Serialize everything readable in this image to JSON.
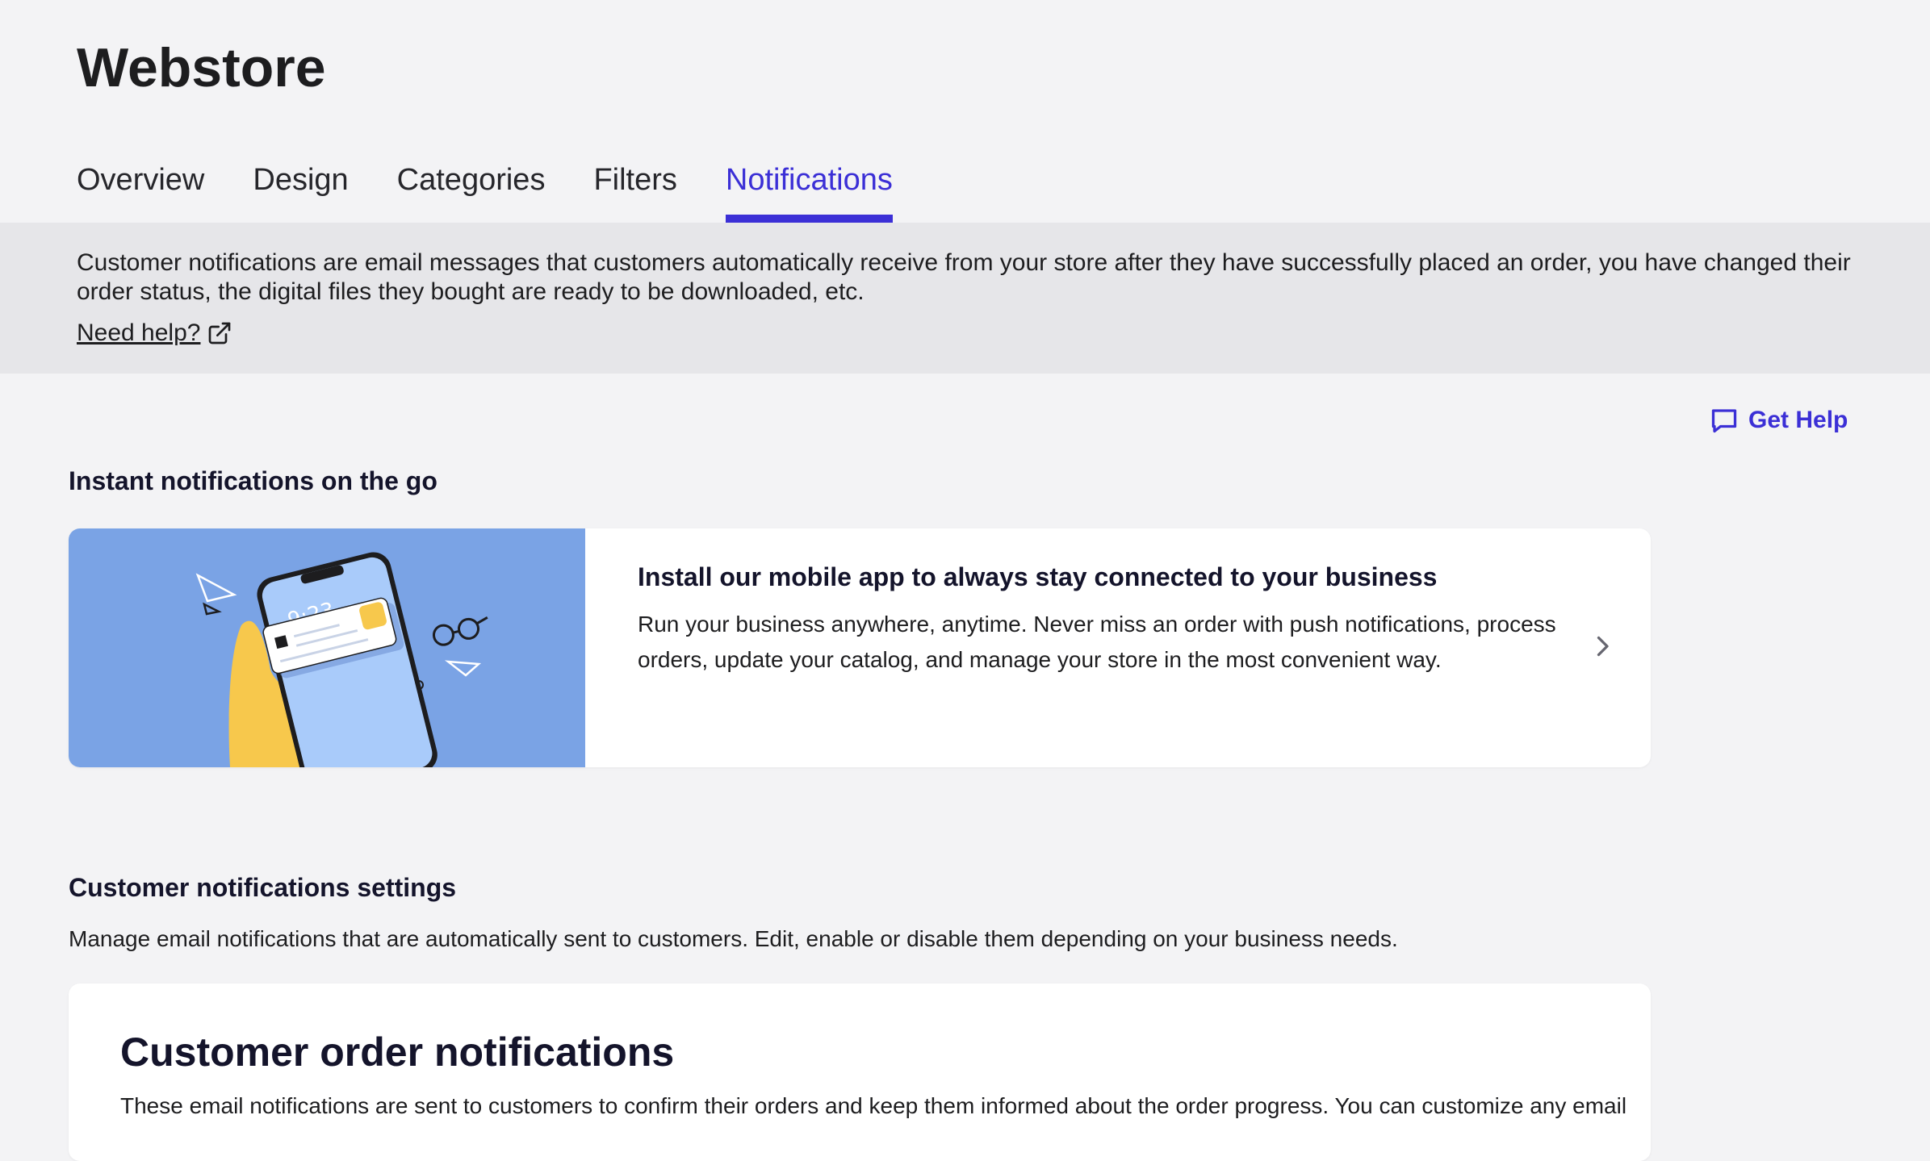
{
  "page": {
    "title": "Webstore"
  },
  "tabs": [
    {
      "label": "Overview",
      "active": false
    },
    {
      "label": "Design",
      "active": false
    },
    {
      "label": "Categories",
      "active": false
    },
    {
      "label": "Filters",
      "active": false
    },
    {
      "label": "Notifications",
      "active": true
    }
  ],
  "info": {
    "text": "Customer notifications are email messages that customers automatically receive from your store after they have successfully placed an order, you have changed their order status, the digital files they bought are ready to be downloaded, etc.",
    "help_link": "Need help?",
    "help_icon": "external-link-icon"
  },
  "get_help": {
    "label": "Get Help",
    "icon": "chat-icon"
  },
  "instant": {
    "heading": "Instant notifications on the go",
    "card_title": "Install our mobile app to always stay connected to your business",
    "card_desc": "Run your business anywhere, anytime. Never miss an order with push notifications, process orders, update your catalog, and manage your store in the most convenient way.",
    "phone_time": "9:23"
  },
  "settings": {
    "heading": "Customer notifications settings",
    "desc": "Manage email notifications that are automatically sent to customers. Edit, enable or disable them depending on your business needs."
  },
  "orders": {
    "title": "Customer order notifications",
    "desc": "These email notifications are sent to customers to confirm their orders and keep them informed about the order progress. You can customize any email"
  },
  "colors": {
    "accent": "#3b2fd6",
    "background": "#f3f3f5",
    "info_bar": "#e6e6e9",
    "illustration_bg": "#7aa3e5"
  }
}
